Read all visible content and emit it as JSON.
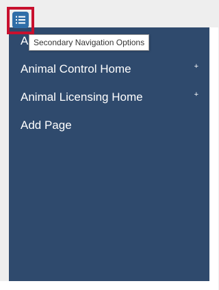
{
  "colors": {
    "nav_background": "#2f4a6d",
    "highlight_border": "#c8102e",
    "toggle_button": "#2f6ea8"
  },
  "toggle": {
    "icon": "list-icon",
    "tooltip": "Secondary Navigation Options"
  },
  "nav": {
    "items": [
      {
        "label": "A",
        "expandable": false
      },
      {
        "label": "Animal Control Home",
        "expandable": true,
        "expand_symbol": "+"
      },
      {
        "label": "Animal Licensing Home",
        "expandable": true,
        "expand_symbol": "+"
      },
      {
        "label": "Add Page",
        "expandable": false
      }
    ]
  }
}
